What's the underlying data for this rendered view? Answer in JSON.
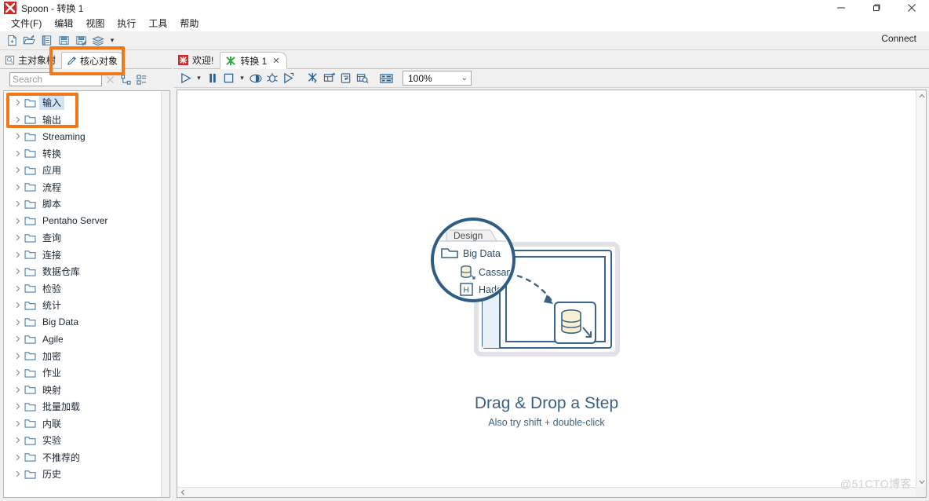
{
  "window": {
    "title": "Spoon - 转换 1",
    "app_icon": "spoon-icon",
    "minimize": "−",
    "maximize": "□",
    "close": "×"
  },
  "menubar": {
    "items": [
      {
        "label": "文件(F)",
        "name": "menu-file"
      },
      {
        "label": "编辑",
        "name": "menu-edit"
      },
      {
        "label": "视图",
        "name": "menu-view"
      },
      {
        "label": "执行",
        "name": "menu-run"
      },
      {
        "label": "工具",
        "name": "menu-tools"
      },
      {
        "label": "帮助",
        "name": "menu-help"
      }
    ]
  },
  "main_toolbar": {
    "icons": [
      {
        "name": "new-file-icon"
      },
      {
        "name": "open-folder-icon"
      },
      {
        "name": "explore-repository-icon"
      },
      {
        "name": "save-icon"
      },
      {
        "name": "save-as-icon"
      },
      {
        "name": "layers-icon"
      }
    ],
    "dropdown_caret": "▾",
    "connect_label": "Connect"
  },
  "left_panel": {
    "tabs": [
      {
        "label": "主对象树",
        "name": "tab-main-object-tree",
        "icon": "tree-icon",
        "active": false
      },
      {
        "label": "核心对象",
        "name": "tab-core-objects",
        "icon": "pencil-icon",
        "active": true
      }
    ],
    "search": {
      "placeholder": "Search",
      "value": "",
      "clear_icon": "clear-x-icon",
      "expand_icon": "expand-all-icon",
      "collapse_icon": "collapse-all-icon"
    },
    "tree_items": [
      {
        "label": "输入",
        "selected": true
      },
      {
        "label": "输出",
        "selected": false
      },
      {
        "label": "Streaming",
        "selected": false
      },
      {
        "label": "转换",
        "selected": false
      },
      {
        "label": "应用",
        "selected": false
      },
      {
        "label": "流程",
        "selected": false
      },
      {
        "label": "脚本",
        "selected": false
      },
      {
        "label": "Pentaho Server",
        "selected": false
      },
      {
        "label": "查询",
        "selected": false
      },
      {
        "label": "连接",
        "selected": false
      },
      {
        "label": "数据仓库",
        "selected": false
      },
      {
        "label": "检验",
        "selected": false
      },
      {
        "label": "统计",
        "selected": false
      },
      {
        "label": "Big Data",
        "selected": false
      },
      {
        "label": "Agile",
        "selected": false
      },
      {
        "label": "加密",
        "selected": false
      },
      {
        "label": "作业",
        "selected": false
      },
      {
        "label": "映射",
        "selected": false
      },
      {
        "label": "批量加载",
        "selected": false
      },
      {
        "label": "内联",
        "selected": false
      },
      {
        "label": "实验",
        "selected": false
      },
      {
        "label": "不推荐的",
        "selected": false
      },
      {
        "label": "历史",
        "selected": false
      }
    ]
  },
  "editor": {
    "tabs": [
      {
        "label": "欢迎!",
        "name": "tab-welcome",
        "icon": "spoon-icon",
        "active": false,
        "closable": false
      },
      {
        "label": "转换 1",
        "name": "tab-transformation-1",
        "icon": "transformation-icon",
        "active": true,
        "closable": true,
        "close_glyph": "✕"
      }
    ],
    "toolbar": {
      "icons": [
        {
          "name": "run-icon"
        },
        {
          "name": "run-options-caret",
          "caret": "▾"
        },
        {
          "name": "pause-icon"
        },
        {
          "name": "stop-icon"
        },
        {
          "name": "stop-options-caret",
          "caret": "▾"
        },
        {
          "name": "preview-icon"
        },
        {
          "name": "debug-icon"
        },
        {
          "name": "replay-icon"
        },
        {
          "name": "transformation-settings-icon"
        },
        {
          "name": "show-last-preview-icon"
        },
        {
          "name": "show-execution-results-icon"
        },
        {
          "name": "analyze-impact-icon"
        },
        {
          "name": "grid-icon"
        }
      ],
      "zoom": {
        "value": "100%",
        "caret": "⌄"
      }
    },
    "canvas": {
      "illustration": {
        "magnifier": {
          "tab_label": "Design",
          "rows": [
            {
              "label": "Big Data",
              "icon": "folder-icon"
            },
            {
              "label": "Cassandr",
              "icon": "cassandra-icon"
            },
            {
              "label": "Hadoop",
              "icon": "hadoop-icon"
            }
          ]
        },
        "step_icon": "database-step-icon"
      },
      "caption_primary": "Drag & Drop a Step",
      "caption_secondary": "Also try shift + double-click"
    },
    "scrollbars": {
      "v_up": "⌃",
      "v_down": "⌄",
      "h_left": "‹"
    }
  },
  "watermark": "@51CTO博客",
  "annotations": {
    "highlight_color": "#f07818",
    "boxes": [
      {
        "name": "highlight-core-objects-tab"
      },
      {
        "name": "highlight-input-output-nodes"
      }
    ]
  }
}
